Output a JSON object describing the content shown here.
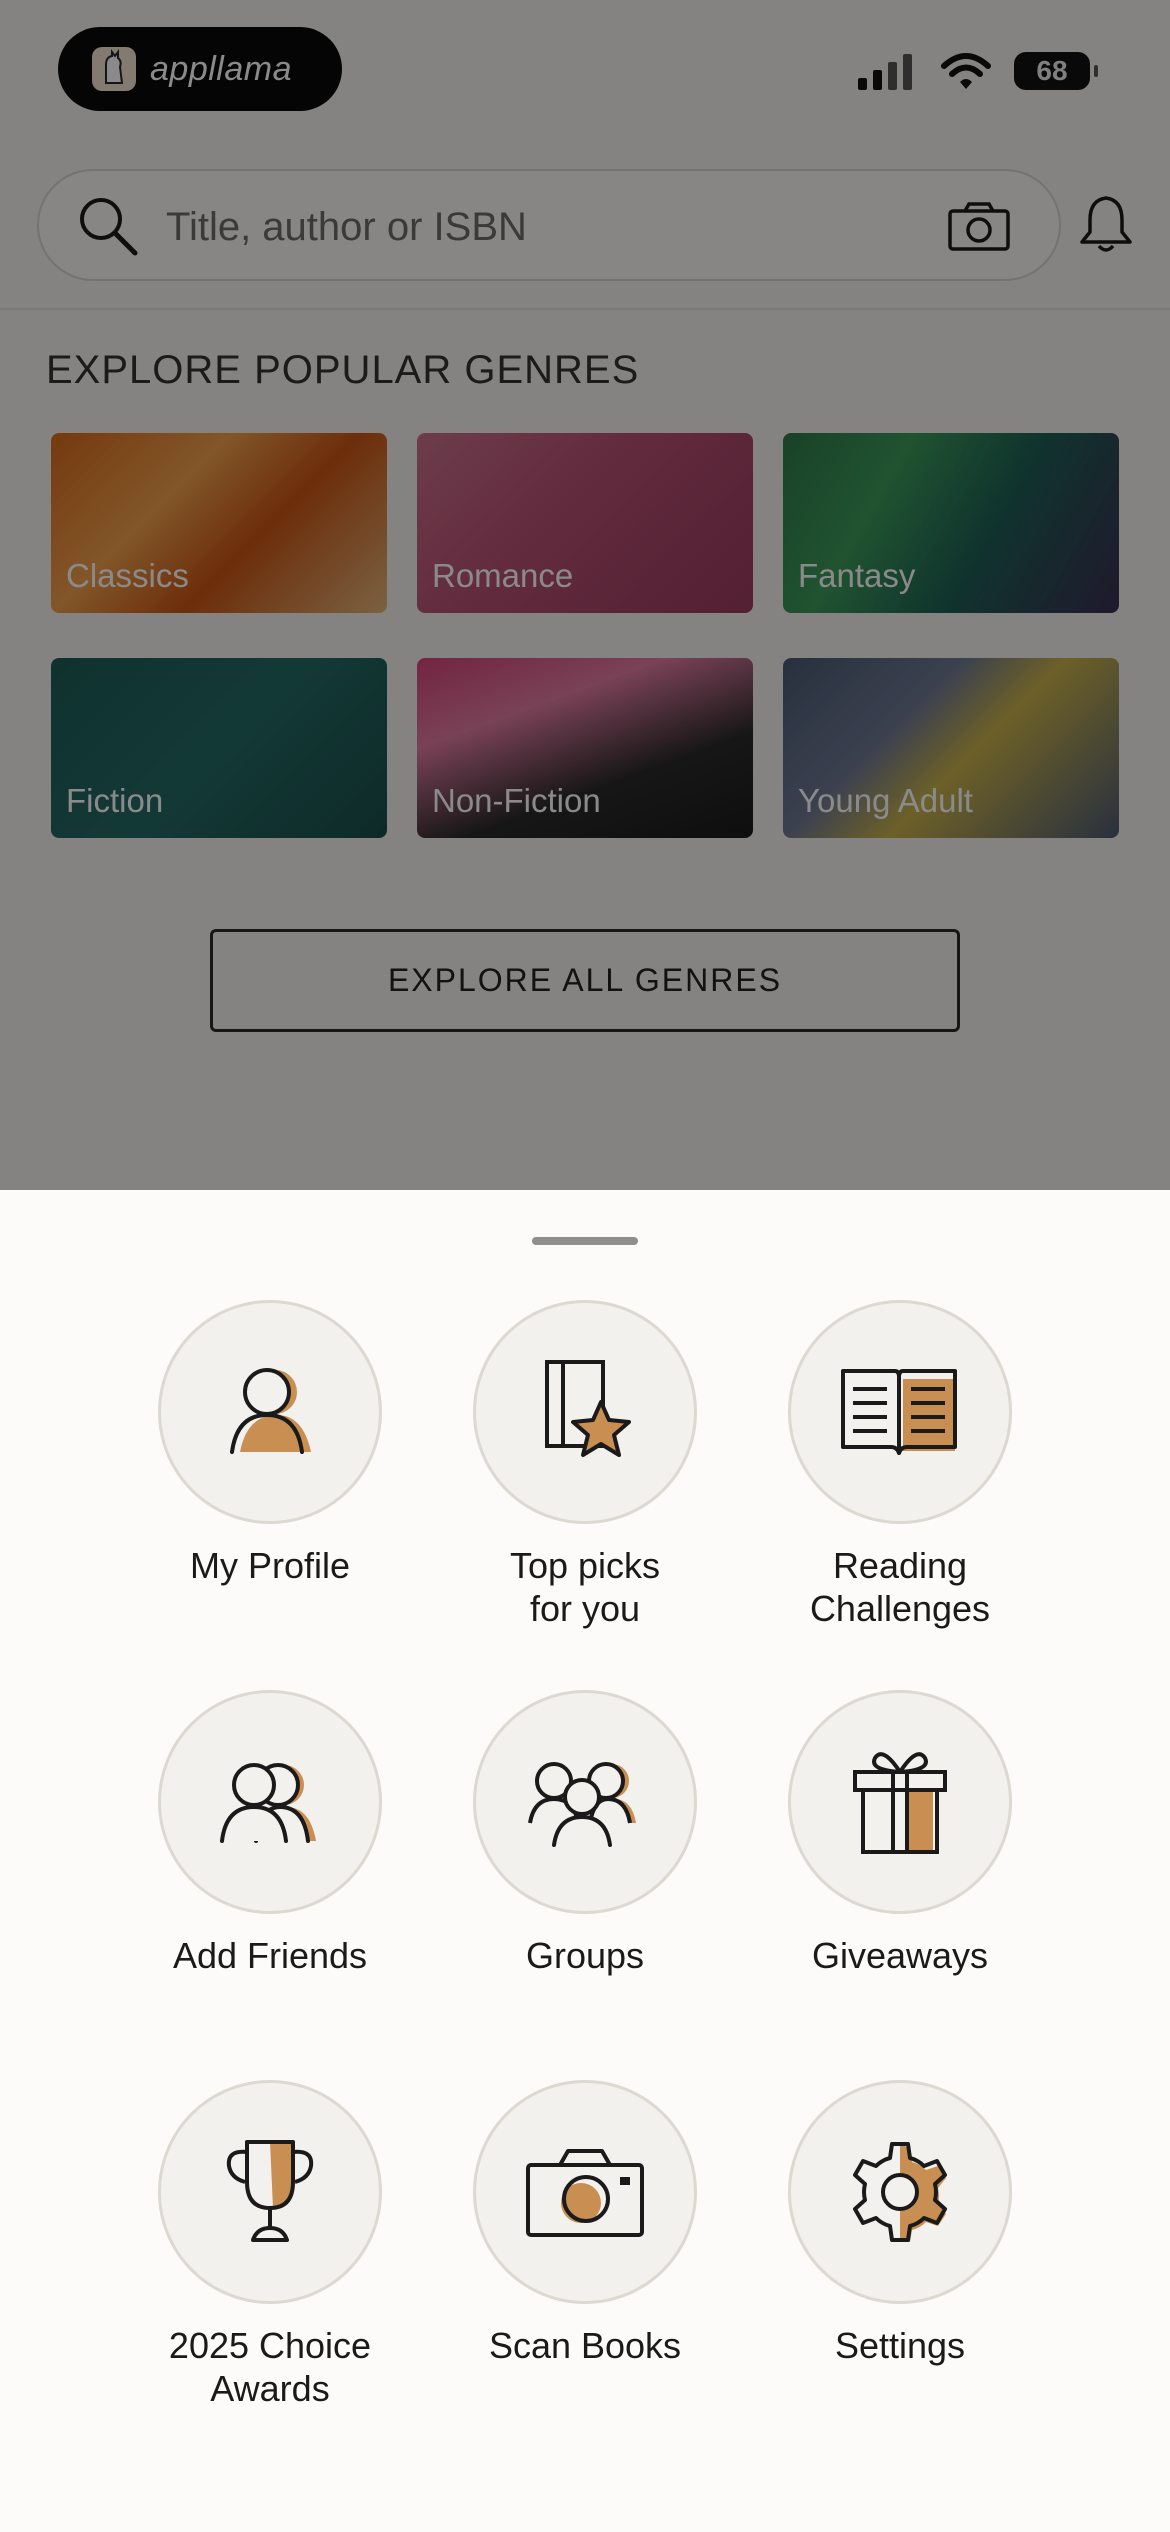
{
  "status_bar": {
    "app_name": "appllama",
    "battery": "68"
  },
  "search": {
    "placeholder": "Title, author or ISBN"
  },
  "genres": {
    "title": "EXPLORE POPULAR GENRES",
    "items": [
      {
        "label": "Classics"
      },
      {
        "label": "Romance"
      },
      {
        "label": "Fantasy"
      },
      {
        "label": "Fiction"
      },
      {
        "label": "Non-Fiction"
      },
      {
        "label": "Young Adult"
      }
    ],
    "explore_all": "EXPLORE ALL GENRES"
  },
  "menu": {
    "items": [
      {
        "label": "My Profile",
        "icon": "profile-icon"
      },
      {
        "label": "Top picks\nfor you",
        "icon": "book-star-icon"
      },
      {
        "label": "Reading\nChallenges",
        "icon": "open-book-icon"
      },
      {
        "label": "Add Friends",
        "icon": "add-friends-icon"
      },
      {
        "label": "Groups",
        "icon": "groups-icon"
      },
      {
        "label": "Giveaways",
        "icon": "gift-icon"
      },
      {
        "label": "2025 Choice\nAwards",
        "icon": "trophy-icon"
      },
      {
        "label": "Scan Books",
        "icon": "camera-icon"
      },
      {
        "label": "Settings",
        "icon": "gear-icon"
      }
    ]
  },
  "colors": {
    "accent": "#c98f52",
    "sheet_bg": "#fcfbf9",
    "circle_bg": "#f3f1ed"
  }
}
